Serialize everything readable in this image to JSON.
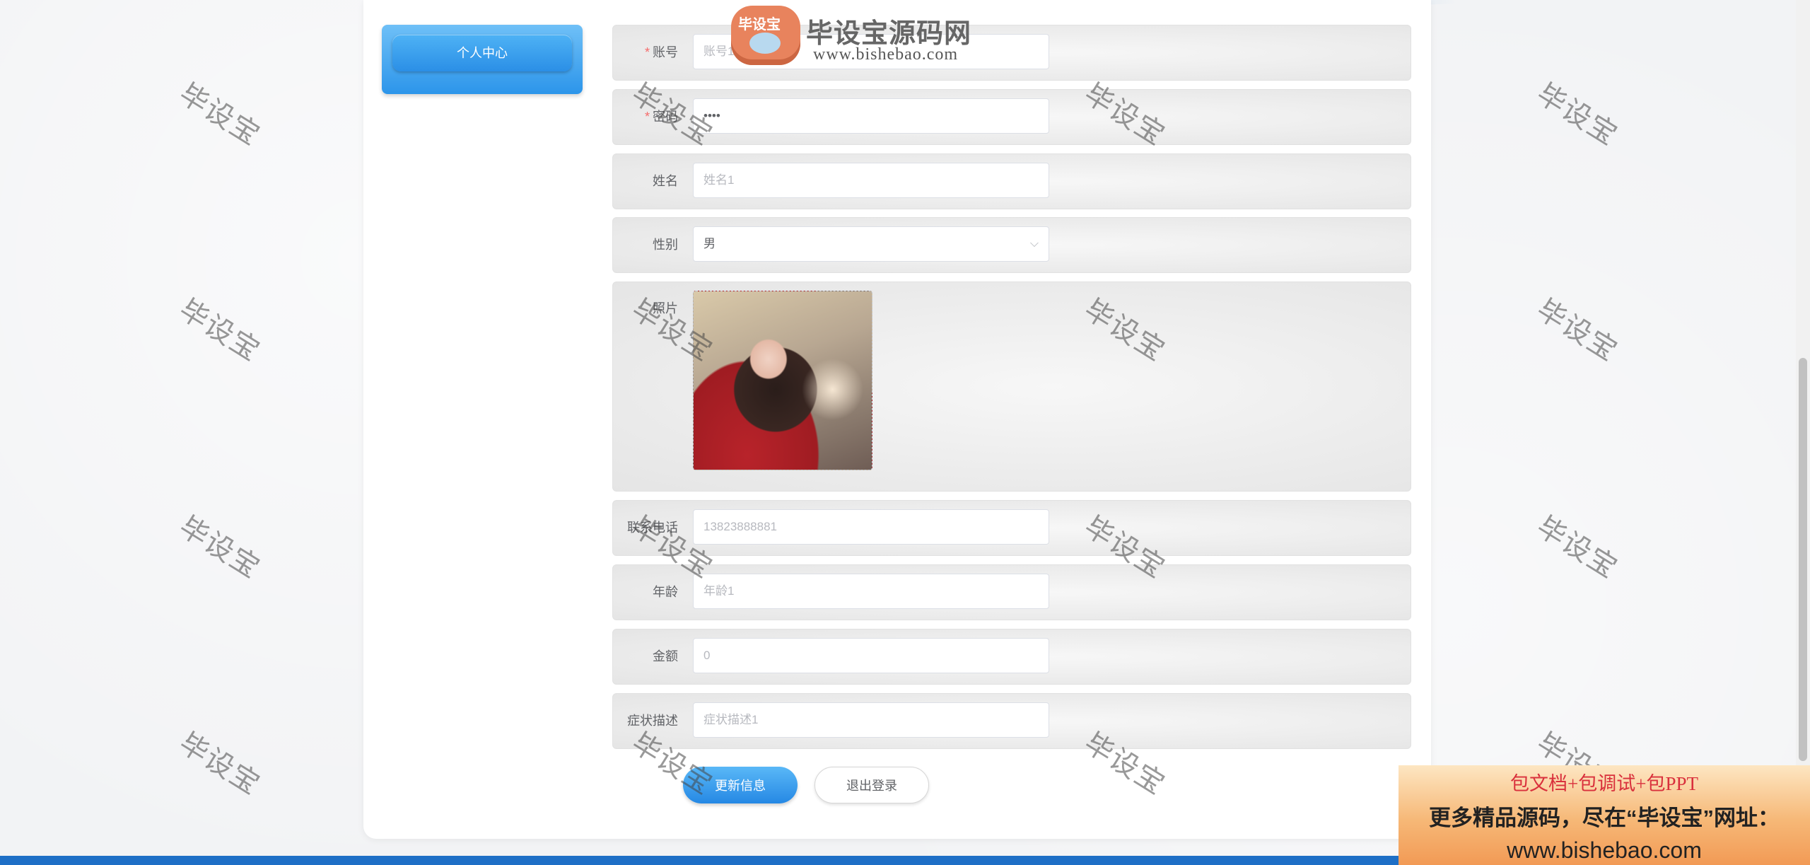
{
  "menu": {
    "personal_center": "个人中心"
  },
  "brand": {
    "badge": "毕设宝",
    "name": "毕设宝源码网",
    "url": "www.bishebao.com"
  },
  "form": {
    "account": {
      "label": "账号",
      "placeholder": "账号1",
      "required": "*"
    },
    "password": {
      "label": "密码",
      "value": "••••",
      "required": "*"
    },
    "name": {
      "label": "姓名",
      "placeholder": "姓名1"
    },
    "gender": {
      "label": "性别",
      "value": "男",
      "arrow": "⌵"
    },
    "photo": {
      "label": "照片"
    },
    "phone": {
      "label": "联系电话",
      "placeholder": "13823888881"
    },
    "age": {
      "label": "年龄",
      "placeholder": "年龄1"
    },
    "amount": {
      "label": "金额",
      "placeholder": "0"
    },
    "symptom": {
      "label": "症状描述",
      "placeholder": "症状描述1"
    }
  },
  "actions": {
    "update": "更新信息",
    "logout": "退出登录"
  },
  "watermark": "毕设宝",
  "ad": {
    "line1": "包文档+包调试+包PPT",
    "line2": "更多精品源码，尽在“毕设宝”网址：",
    "line3": "www.bishebao.com"
  },
  "colors": {
    "primary": "#2b8fe6",
    "required": "#f56c6c",
    "bottom_bar": "#1e6fc6"
  }
}
